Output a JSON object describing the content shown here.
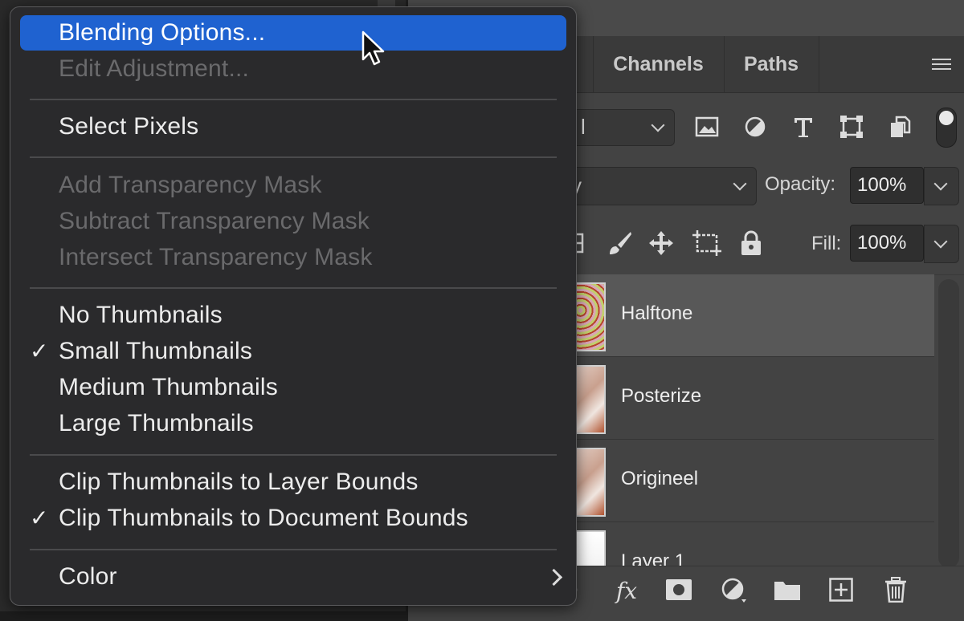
{
  "panel": {
    "tabs": [
      "Channels",
      "Paths"
    ],
    "kind_filter_value": "l",
    "blend_mode_value": "y",
    "opacity_label": "Opacity:",
    "opacity_value": "100%",
    "fill_label": "Fill:",
    "fill_value": "100%",
    "layers": [
      {
        "name": "Halftone",
        "selected": true
      },
      {
        "name": "Posterize",
        "selected": false
      },
      {
        "name": "Origineel",
        "selected": false
      },
      {
        "name": "Layer 1",
        "selected": false
      }
    ],
    "footer_icons": [
      "fx-icon",
      "mask-icon",
      "adjustment-icon",
      "folder-icon",
      "new-layer-icon",
      "trash-icon"
    ]
  },
  "menu": {
    "items": [
      {
        "label": "Blending Options...",
        "state": "highlighted"
      },
      {
        "label": "Edit Adjustment...",
        "state": "disabled"
      },
      {
        "label": "Select Pixels",
        "state": "enabled"
      },
      {
        "label": "Add Transparency Mask",
        "state": "disabled"
      },
      {
        "label": "Subtract Transparency Mask",
        "state": "disabled"
      },
      {
        "label": "Intersect Transparency Mask",
        "state": "disabled"
      },
      {
        "label": "No Thumbnails",
        "state": "enabled"
      },
      {
        "label": "Small Thumbnails",
        "state": "checked"
      },
      {
        "label": "Medium Thumbnails",
        "state": "enabled"
      },
      {
        "label": "Large Thumbnails",
        "state": "enabled"
      },
      {
        "label": "Clip Thumbnails to Layer Bounds",
        "state": "enabled"
      },
      {
        "label": "Clip Thumbnails to Document Bounds",
        "state": "checked"
      },
      {
        "label": "Color",
        "state": "submenu"
      }
    ],
    "check_glyph": "✓"
  },
  "colors": {
    "highlight": "#1f62d0",
    "menu_bg": "#2a2a2c",
    "panel_bg": "#434343"
  }
}
